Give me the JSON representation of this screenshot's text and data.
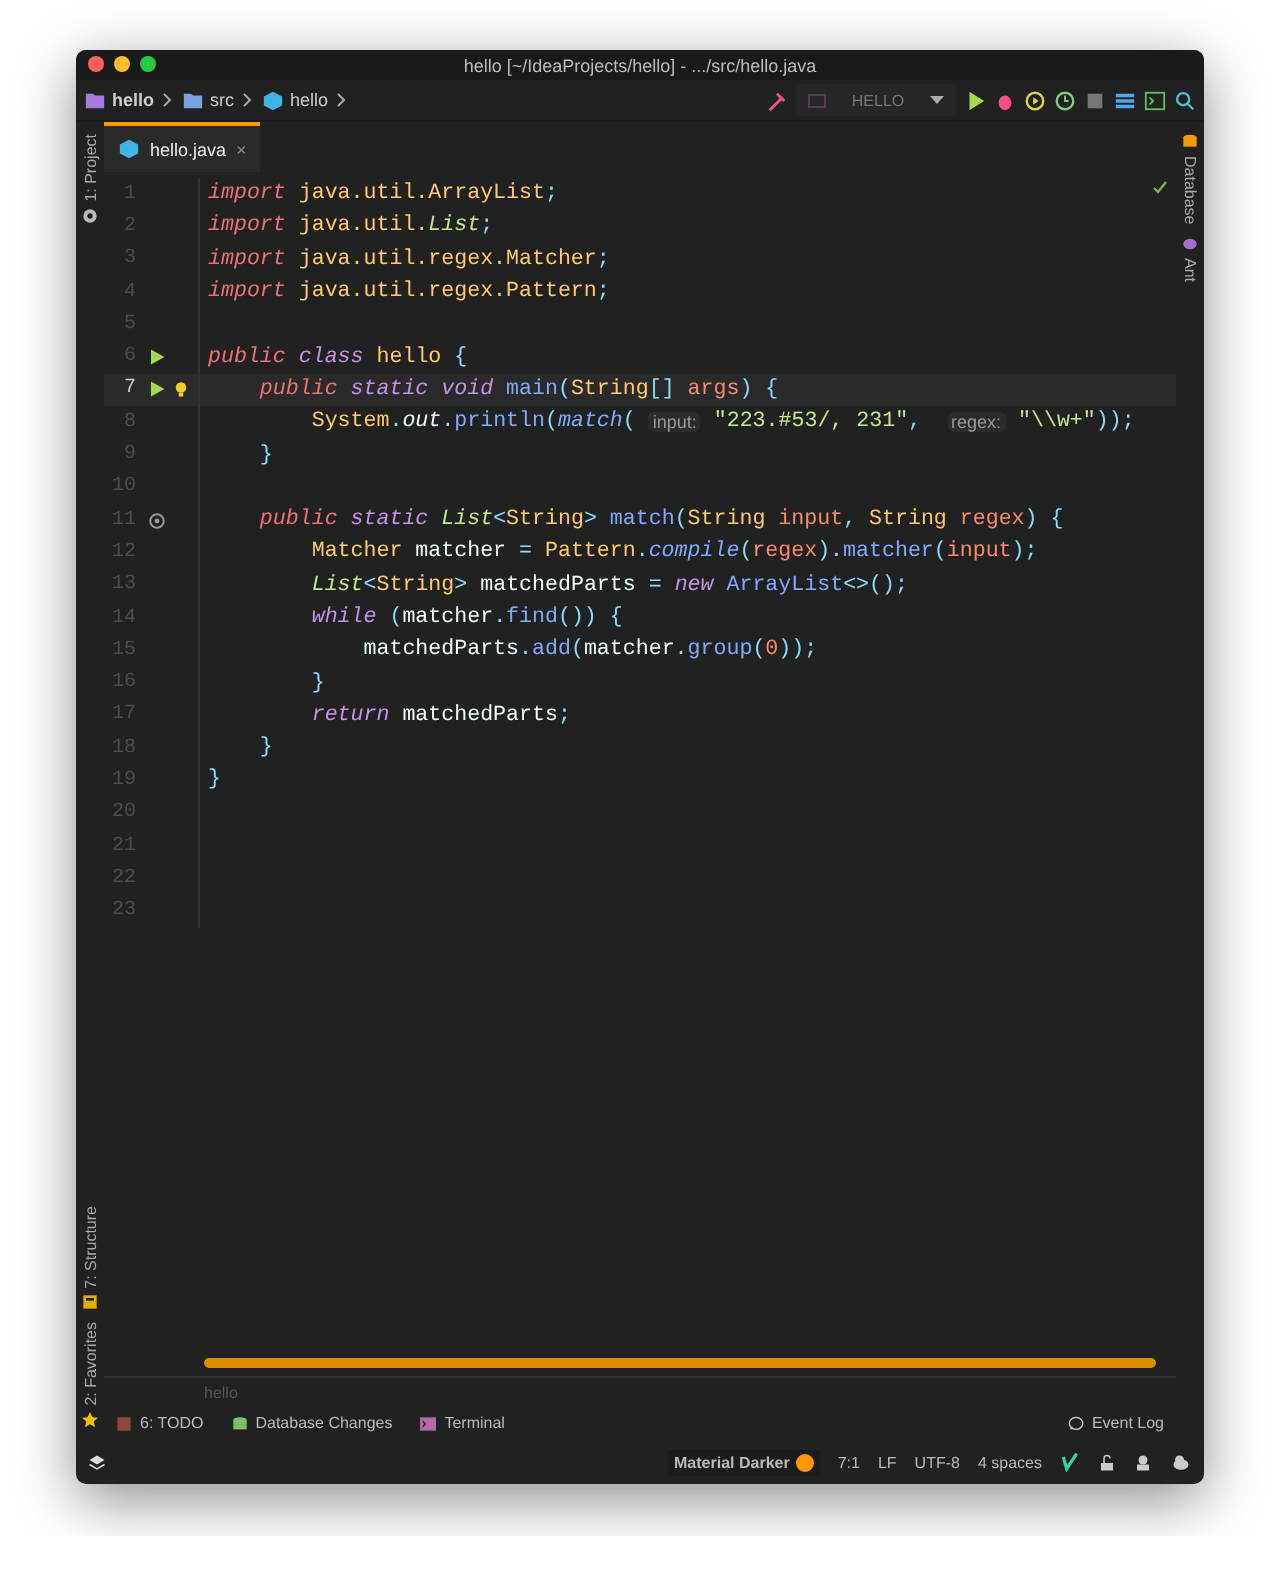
{
  "window": {
    "title": "hello [~/IdeaProjects/hello] - .../src/hello.java"
  },
  "breadcrumbs": [
    {
      "label": "hello",
      "kind": "project"
    },
    {
      "label": "src",
      "kind": "folder"
    },
    {
      "label": "hello",
      "kind": "class"
    }
  ],
  "run_config": {
    "label": "HELLO"
  },
  "left_tools": [
    {
      "label": "1: Project",
      "kind": "project"
    },
    {
      "label": "7: Structure",
      "kind": "structure"
    },
    {
      "label": "2: Favorites",
      "kind": "favorites"
    }
  ],
  "right_tools": [
    {
      "label": "Database",
      "kind": "database"
    },
    {
      "label": "Ant",
      "kind": "ant"
    }
  ],
  "tabs": [
    {
      "label": "hello.java",
      "close": "×",
      "selected": true
    }
  ],
  "editor": {
    "lines": [
      {
        "number": "1",
        "current": false,
        "tokens": [
          {
            "kind": "mod",
            "text": "import "
          },
          {
            "kind": "type",
            "text": "java.util.ArrayList"
          },
          {
            "kind": "punct",
            "text": ";"
          }
        ]
      },
      {
        "number": "2",
        "current": false,
        "tokens": [
          {
            "kind": "mod",
            "text": "import "
          },
          {
            "kind": "type",
            "text": "java.util."
          },
          {
            "kind": "itype",
            "text": "List"
          },
          {
            "kind": "punct",
            "text": ";"
          }
        ]
      },
      {
        "number": "3",
        "current": false,
        "tokens": [
          {
            "kind": "mod",
            "text": "import "
          },
          {
            "kind": "type",
            "text": "java.util.regex.Matcher"
          },
          {
            "kind": "punct",
            "text": ";"
          }
        ]
      },
      {
        "number": "4",
        "current": false,
        "tokens": [
          {
            "kind": "mod",
            "text": "import "
          },
          {
            "kind": "type",
            "text": "java.util.regex.Pattern"
          },
          {
            "kind": "punct",
            "text": ";"
          }
        ]
      },
      {
        "number": "5",
        "current": false
      },
      {
        "number": "6",
        "current": false,
        "kind": "run",
        "tokens": [
          {
            "kind": "mod",
            "text": "public "
          },
          {
            "kind": "kw",
            "text": "class "
          },
          {
            "kind": "type",
            "text": "hello "
          },
          {
            "kind": "punct",
            "text": "{"
          }
        ]
      },
      {
        "number": "7",
        "current": true,
        "kind": "run",
        "bulb": true,
        "tokens": [
          {
            "kind": "mod",
            "text": "    public "
          },
          {
            "kind": "kw",
            "text": "static void "
          },
          {
            "kind": "method",
            "text": "main"
          },
          {
            "kind": "punct",
            "text": "("
          },
          {
            "kind": "type",
            "text": "String"
          },
          {
            "kind": "punct",
            "text": "[] "
          },
          {
            "kind": "param",
            "text": "args"
          },
          {
            "kind": "punct",
            "text": ") {"
          }
        ]
      },
      {
        "number": "8",
        "current": false,
        "tokens": [
          {
            "kind": "type",
            "text": "        System"
          },
          {
            "kind": "punct",
            "text": "."
          },
          {
            "kind": "field",
            "text": "out"
          },
          {
            "kind": "punct",
            "text": "."
          },
          {
            "kind": "method",
            "text": "println"
          },
          {
            "kind": "punct",
            "text": "("
          },
          {
            "kind": "imethod",
            "text": "match"
          },
          {
            "kind": "punct",
            "text": "( "
          },
          {
            "kind": "hint",
            "text": "input:"
          },
          {
            "kind": "string",
            "text": " \"223.#53/, 231\""
          },
          {
            "kind": "punct",
            "text": ",  "
          },
          {
            "kind": "hint",
            "text": "regex:"
          },
          {
            "kind": "string",
            "text": " \"\\\\w+\""
          },
          {
            "kind": "punct",
            "text": "));"
          }
        ]
      },
      {
        "number": "9",
        "current": false,
        "tokens": [
          {
            "kind": "punct",
            "text": "    }"
          }
        ]
      },
      {
        "number": "10",
        "current": false
      },
      {
        "number": "11",
        "current": false,
        "kind": "override",
        "tokens": [
          {
            "kind": "mod",
            "text": "    public "
          },
          {
            "kind": "kw",
            "text": "static "
          },
          {
            "kind": "itype",
            "text": "List"
          },
          {
            "kind": "punct",
            "text": "<"
          },
          {
            "kind": "type",
            "text": "String"
          },
          {
            "kind": "punct",
            "text": "> "
          },
          {
            "kind": "method",
            "text": "match"
          },
          {
            "kind": "punct",
            "text": "("
          },
          {
            "kind": "type",
            "text": "String "
          },
          {
            "kind": "param",
            "text": "input"
          },
          {
            "kind": "punct",
            "text": ", "
          },
          {
            "kind": "type",
            "text": "String "
          },
          {
            "kind": "param",
            "text": "regex"
          },
          {
            "kind": "punct",
            "text": ") {"
          }
        ]
      },
      {
        "number": "12",
        "current": false,
        "tokens": [
          {
            "kind": "type",
            "text": "        Matcher "
          },
          {
            "kind": "plain",
            "text": "matcher "
          },
          {
            "kind": "punct",
            "text": "= "
          },
          {
            "kind": "type",
            "text": "Pattern"
          },
          {
            "kind": "punct",
            "text": "."
          },
          {
            "kind": "imethod",
            "text": "compile"
          },
          {
            "kind": "punct",
            "text": "("
          },
          {
            "kind": "param",
            "text": "regex"
          },
          {
            "kind": "punct",
            "text": ")."
          },
          {
            "kind": "method",
            "text": "matcher"
          },
          {
            "kind": "punct",
            "text": "("
          },
          {
            "kind": "param",
            "text": "input"
          },
          {
            "kind": "punct",
            "text": ");"
          }
        ]
      },
      {
        "number": "13",
        "current": false,
        "tokens": [
          {
            "kind": "itype",
            "text": "        List"
          },
          {
            "kind": "punct",
            "text": "<"
          },
          {
            "kind": "type",
            "text": "String"
          },
          {
            "kind": "punct",
            "text": "> "
          },
          {
            "kind": "plain",
            "text": "matchedParts "
          },
          {
            "kind": "punct",
            "text": "= "
          },
          {
            "kind": "kw",
            "text": "new "
          },
          {
            "kind": "method",
            "text": "ArrayList"
          },
          {
            "kind": "punct",
            "text": "<>();"
          }
        ]
      },
      {
        "number": "14",
        "current": false,
        "tokens": [
          {
            "kind": "kw",
            "text": "        while "
          },
          {
            "kind": "punct",
            "text": "("
          },
          {
            "kind": "plain",
            "text": "matcher"
          },
          {
            "kind": "punct",
            "text": "."
          },
          {
            "kind": "method",
            "text": "find"
          },
          {
            "kind": "punct",
            "text": "()) {"
          }
        ]
      },
      {
        "number": "15",
        "current": false,
        "tokens": [
          {
            "kind": "plain",
            "text": "            matchedParts"
          },
          {
            "kind": "punct",
            "text": "."
          },
          {
            "kind": "method",
            "text": "add"
          },
          {
            "kind": "punct",
            "text": "("
          },
          {
            "kind": "plain",
            "text": "matcher"
          },
          {
            "kind": "punct",
            "text": "."
          },
          {
            "kind": "method",
            "text": "group"
          },
          {
            "kind": "punct",
            "text": "("
          },
          {
            "kind": "number",
            "text": "0"
          },
          {
            "kind": "punct",
            "text": "));"
          }
        ]
      },
      {
        "number": "16",
        "current": false,
        "tokens": [
          {
            "kind": "punct",
            "text": "        }"
          }
        ]
      },
      {
        "number": "17",
        "current": false,
        "tokens": [
          {
            "kind": "kw",
            "text": "        return "
          },
          {
            "kind": "plain",
            "text": "matchedParts"
          },
          {
            "kind": "punct",
            "text": ";"
          }
        ]
      },
      {
        "number": "18",
        "current": false,
        "tokens": [
          {
            "kind": "punct",
            "text": "    }"
          }
        ]
      },
      {
        "number": "19",
        "current": false,
        "tokens": [
          {
            "kind": "punct",
            "text": "}"
          }
        ]
      },
      {
        "number": "20",
        "current": false
      },
      {
        "number": "21",
        "current": false
      },
      {
        "number": "22",
        "current": false
      },
      {
        "number": "23",
        "current": false
      }
    ]
  },
  "path": "hello",
  "bottom_tools": [
    {
      "label": "6: TODO",
      "kind": "todo"
    },
    {
      "label": "Database Changes",
      "kind": "database"
    },
    {
      "label": "Terminal",
      "kind": "terminal"
    }
  ],
  "event_log": "Event Log",
  "status": {
    "theme": "Material Darker",
    "items": [
      "7:1",
      "LF",
      "UTF-8",
      "4 spaces"
    ]
  }
}
